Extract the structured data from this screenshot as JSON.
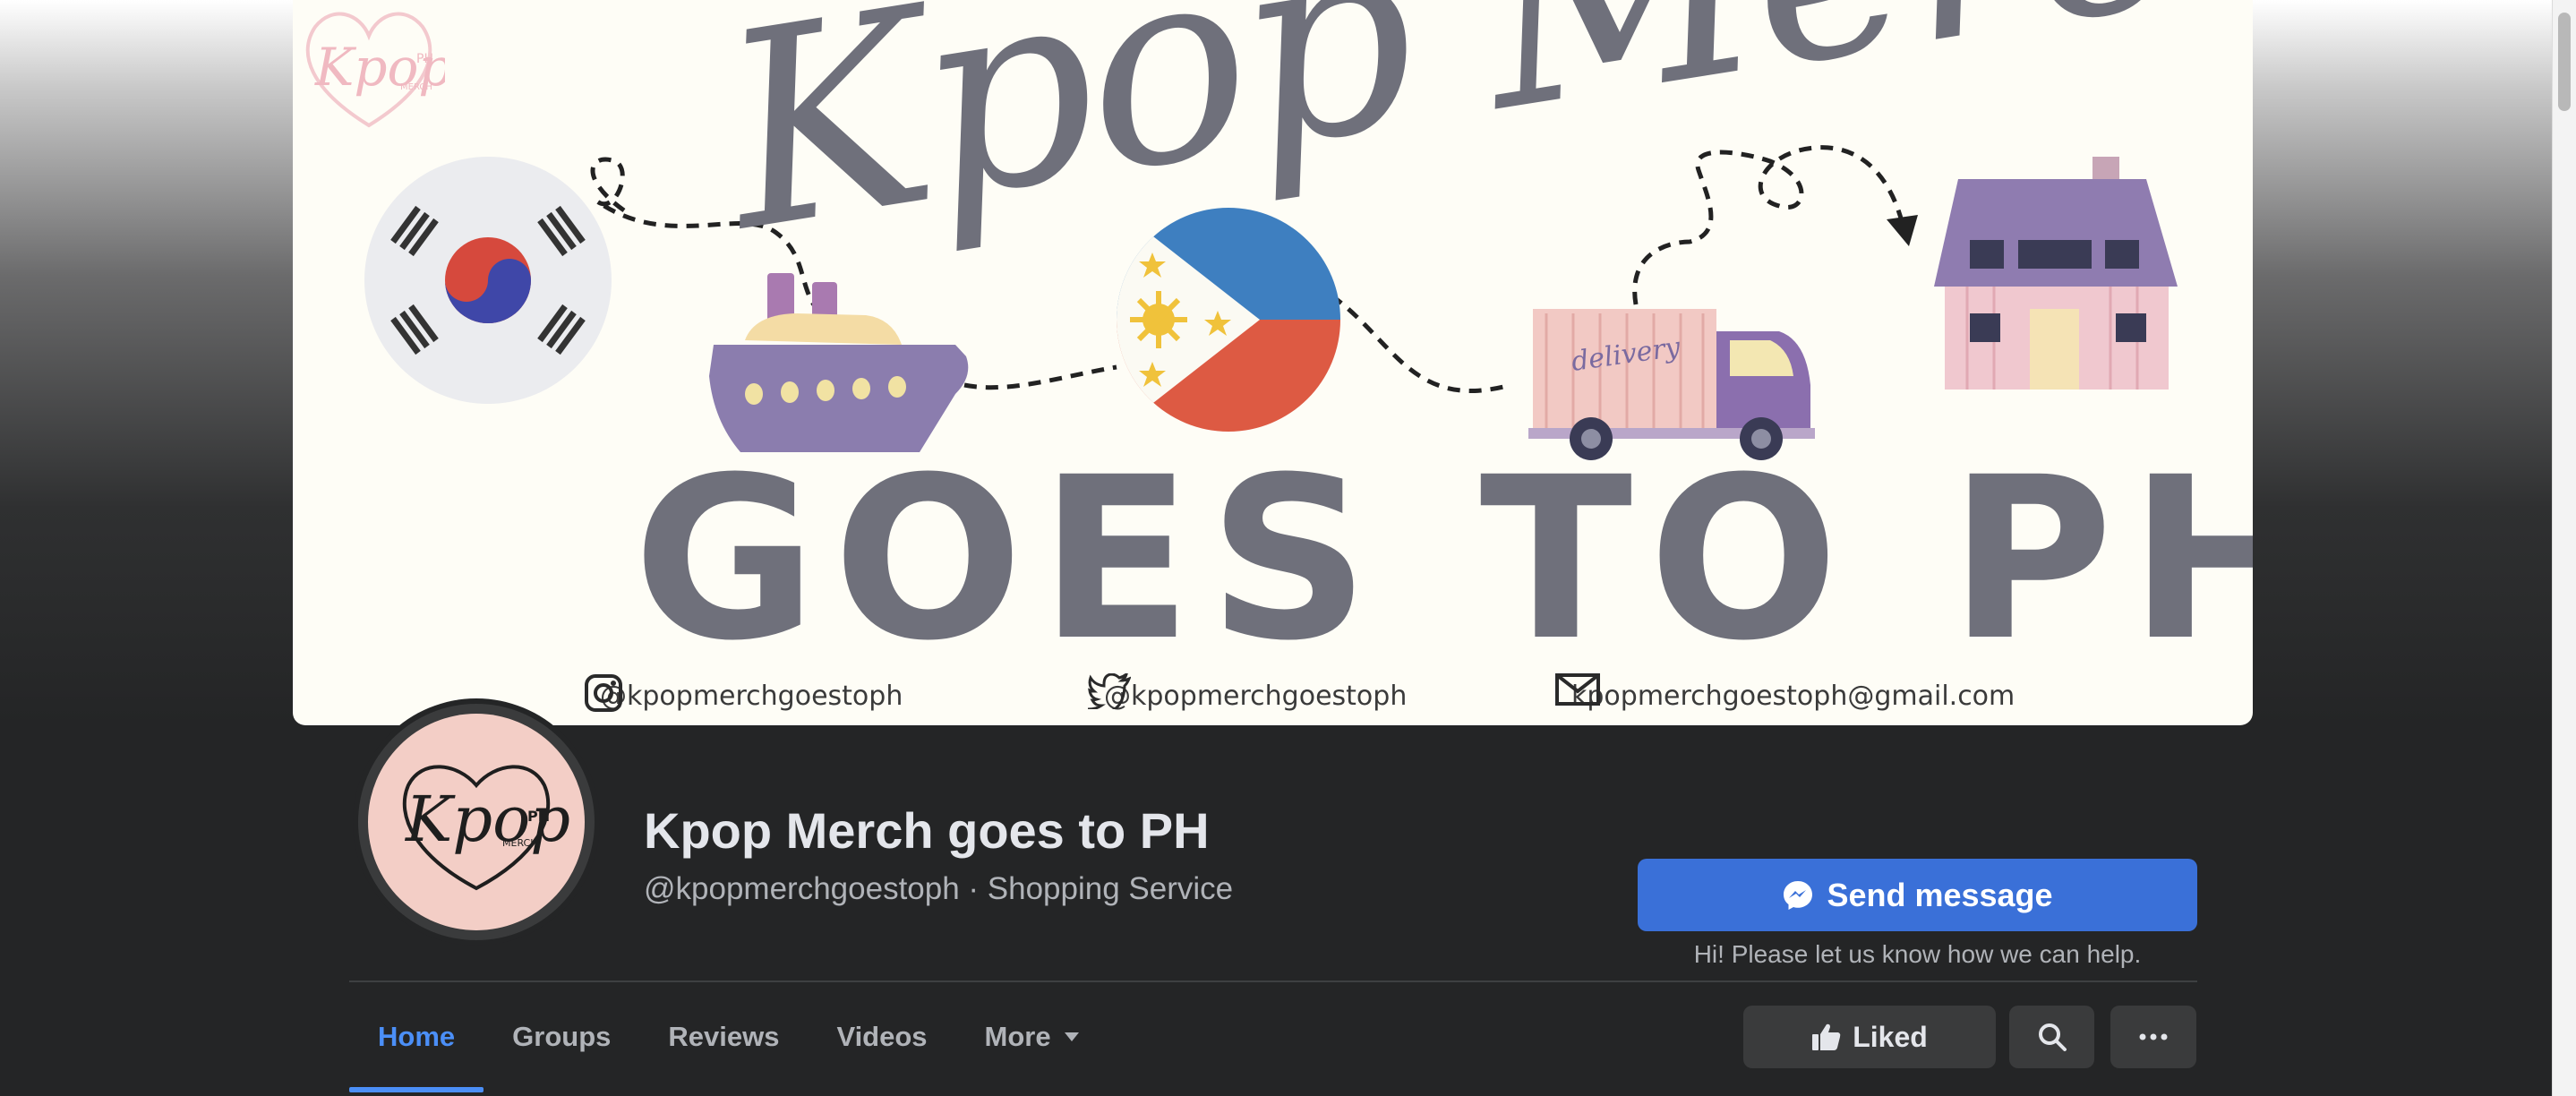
{
  "cover": {
    "script_title": "Kpop Merch",
    "big_title": "GOES TO PH",
    "truck_text": "delivery",
    "watermark_text": "Kpop",
    "watermark_small_1": "PH",
    "watermark_small_2": "MERCH",
    "contacts": {
      "instagram": "@kpopmerchgoestoph",
      "twitter": "@kpopmerchgoestoph",
      "email": "kpopmerchgoestoph@gmail.com"
    }
  },
  "profile": {
    "logo_text": "Kpop",
    "logo_small_1": "PH",
    "logo_small_2": "MERCH",
    "name": "Kpop Merch goes to PH",
    "subtitle": "@kpopmerchgoestoph · Shopping Service"
  },
  "actions": {
    "send_message": "Send message",
    "send_hint": "Hi! Please let us know how we can help.",
    "liked": "Liked"
  },
  "tabs": [
    {
      "label": "Home",
      "active": true
    },
    {
      "label": "Groups",
      "active": false
    },
    {
      "label": "Reviews",
      "active": false
    },
    {
      "label": "Videos",
      "active": false
    },
    {
      "label": "More",
      "active": false
    }
  ],
  "colors": {
    "accent": "#3a70d8",
    "active_tab": "#4b8ff7",
    "background": "#242526"
  },
  "icons": [
    "instagram-icon",
    "twitter-icon",
    "email-icon",
    "messenger-icon",
    "like-icon",
    "search-icon",
    "more-icon",
    "caret-down-icon"
  ]
}
